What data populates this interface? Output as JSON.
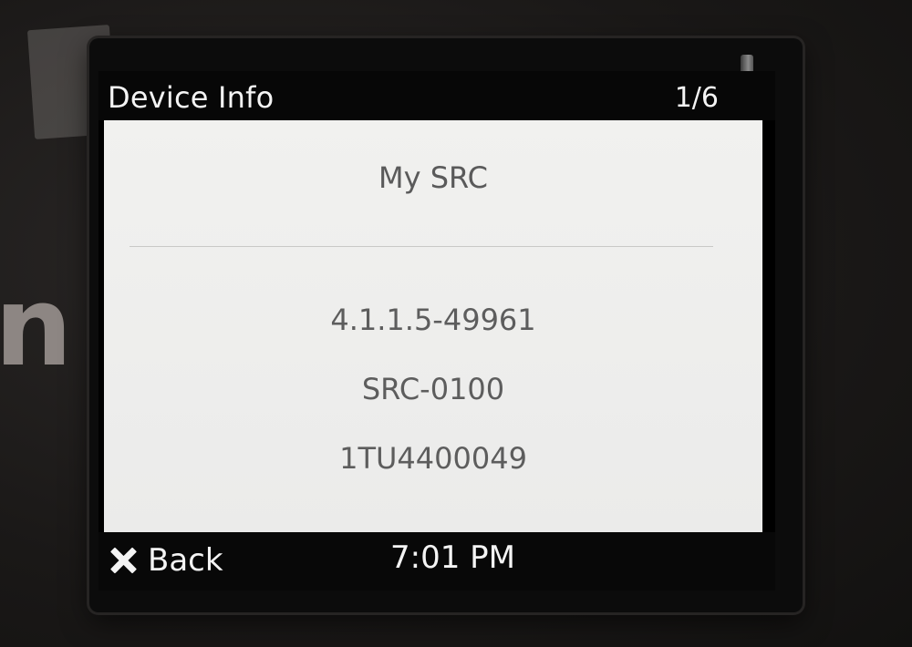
{
  "header": {
    "title": "Device Info",
    "page_indicator": "1/6"
  },
  "device_info": {
    "name": "My SRC",
    "firmware_version": "4.1.1.5-49961",
    "model": "SRC-0100",
    "serial_number": "1TU4400049"
  },
  "footer": {
    "back_label": "Back",
    "back_icon": "close-x-icon",
    "time": "7:01 PM"
  },
  "colors": {
    "bar_background": "#070707",
    "content_background": "#efefed",
    "content_text": "#5d5d5d",
    "bar_text": "#f4f4f4"
  }
}
